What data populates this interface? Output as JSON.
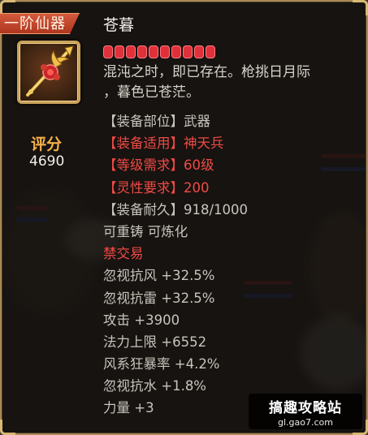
{
  "grade": "一阶仙器",
  "item": {
    "name": "苍暮",
    "stars": 10,
    "description": [
      "混沌之时，即已存在。枪挑日月际",
      "，暮色已苍茫。"
    ],
    "icon": "golden-spear-icon"
  },
  "score": {
    "label": "评分",
    "value": "4690"
  },
  "attributes": [
    {
      "text": "【装备部位】武器",
      "color": "grey"
    },
    {
      "text": "【装备适用】神天兵",
      "color": "red"
    },
    {
      "text": "【等级需求】60级",
      "color": "red"
    },
    {
      "text": "【灵性要求】200",
      "color": "red"
    },
    {
      "text": "【装备耐久】918/1000",
      "color": "grey"
    },
    {
      "text": "可重铸 可炼化",
      "color": "grey"
    },
    {
      "text": "禁交易",
      "color": "red"
    },
    {
      "text": "忽视抗风 +32.5%",
      "color": "grey"
    },
    {
      "text": "忽视抗雷 +32.5%",
      "color": "grey"
    },
    {
      "text": "攻击 +3900",
      "color": "grey"
    },
    {
      "text": "法力上限 +6552",
      "color": "grey"
    },
    {
      "text": "风系狂暴率 +4.2%",
      "color": "grey"
    },
    {
      "text": "忽视抗水 +1.8%",
      "color": "grey"
    },
    {
      "text": "力量 +3",
      "color": "grey"
    }
  ],
  "watermark": {
    "title": "搞趣攻略站",
    "url": "gl.gao7.com"
  },
  "colors": {
    "accent_red": "#f04a45",
    "score_orange": "#f7b04a",
    "frame_gold": "#c9a25a"
  }
}
